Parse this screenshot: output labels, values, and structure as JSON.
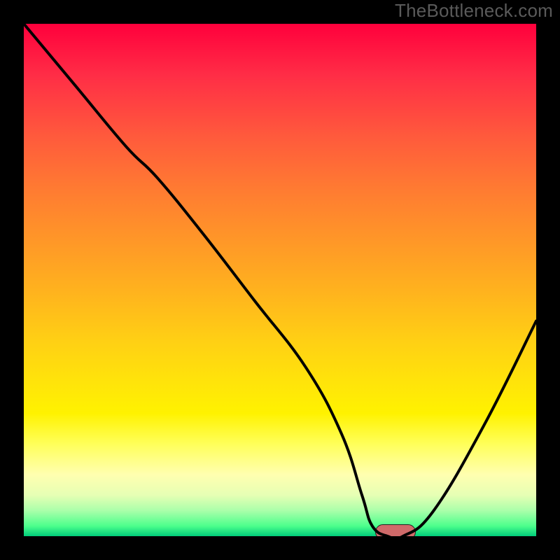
{
  "watermark": "TheBottleneck.com",
  "chart_data": {
    "type": "line",
    "title": "",
    "xlabel": "",
    "ylabel": "",
    "xlim": [
      0,
      100
    ],
    "ylim": [
      0,
      100
    ],
    "x": [
      0,
      10,
      20,
      26,
      35,
      45,
      55,
      62,
      66,
      68,
      71,
      74,
      80,
      90,
      100
    ],
    "values": [
      100,
      88,
      76,
      70,
      59,
      46,
      33,
      20,
      8,
      2,
      0,
      0,
      5,
      22,
      42
    ],
    "marker": {
      "x": 72.5,
      "y": 0
    },
    "colors": {
      "top": "#ff003c",
      "mid": "#ffe40a",
      "bottom": "#00cc7a",
      "marker": "#d06a6a",
      "curve": "#000000"
    }
  }
}
